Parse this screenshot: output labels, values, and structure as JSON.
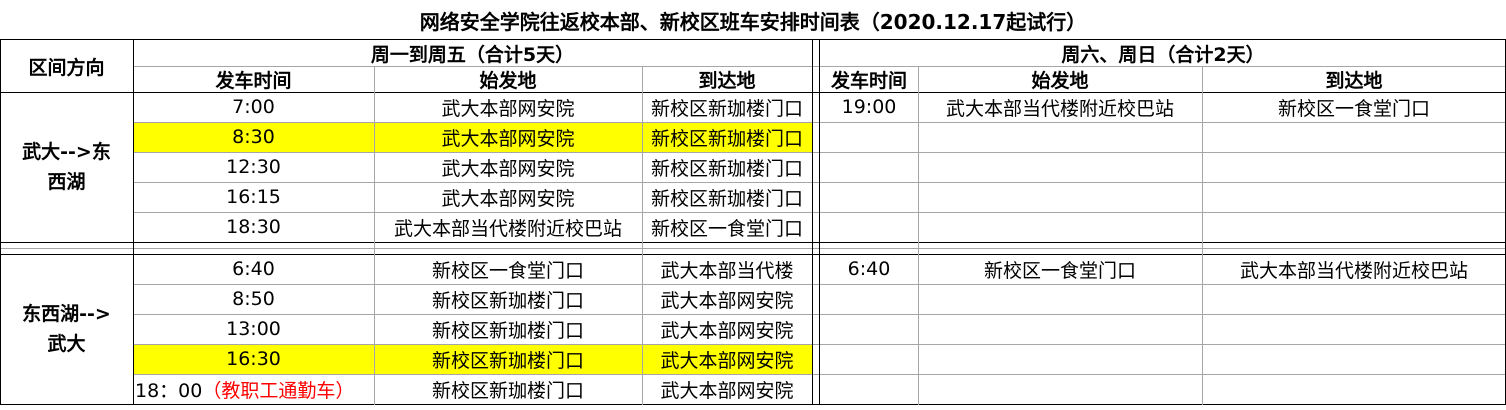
{
  "title": "网络安全学院往返校本部、新校区班车安排时间表（2020.12.17起试行）",
  "header": {
    "direction": "区间方向",
    "weekday_group": "周一到周五（合计5天）",
    "weekend_group": "周六、周日（合计2天）",
    "depart_time": "发车时间",
    "origin": "始发地",
    "destination": "到达地"
  },
  "sections": [
    {
      "direction_line1": "武大-->东",
      "direction_line2": "西湖",
      "weekday_rows": [
        {
          "time": "7:00",
          "origin": "武大本部网安院",
          "destination": "新校区新珈楼门口",
          "highlight": false
        },
        {
          "time": "8:30",
          "origin": "武大本部网安院",
          "destination": "新校区新珈楼门口",
          "highlight": true
        },
        {
          "time": "12:30",
          "origin": "武大本部网安院",
          "destination": "新校区新珈楼门口",
          "highlight": false
        },
        {
          "time": "16:15",
          "origin": "武大本部网安院",
          "destination": "新校区新珈楼门口",
          "highlight": false
        },
        {
          "time": "18:30",
          "origin": "武大本部当代楼附近校巴站",
          "destination": "新校区一食堂门口",
          "highlight": false
        }
      ],
      "weekend_rows": [
        {
          "time": "19:00",
          "origin": "武大本部当代楼附近校巴站",
          "destination": "新校区一食堂门口"
        }
      ]
    },
    {
      "direction_line1": "东西湖-->",
      "direction_line2": "武大",
      "weekday_rows": [
        {
          "time": "6:40",
          "origin": "新校区一食堂门口",
          "destination": "武大本部当代楼",
          "highlight": false
        },
        {
          "time": "8:50",
          "origin": "新校区新珈楼门口",
          "destination": "武大本部网安院",
          "highlight": false
        },
        {
          "time": "13:00",
          "origin": "新校区新珈楼门口",
          "destination": "武大本部网安院",
          "highlight": false
        },
        {
          "time": "16:30",
          "origin": "新校区新珈楼门口",
          "destination": "武大本部网安院",
          "highlight": true
        },
        {
          "time": "18：00",
          "time_note": "（教职工通勤车）",
          "origin": "新校区新珈楼门口",
          "destination": "武大本部网安院",
          "highlight": false
        }
      ],
      "weekend_rows": [
        {
          "time": "6:40",
          "origin": "新校区一食堂门口",
          "destination": "武大本部当代楼附近校巴站"
        }
      ]
    }
  ],
  "colors": {
    "highlight": "#ffff00",
    "note_red": "#ff0000",
    "grid": "#a6a6a6"
  }
}
